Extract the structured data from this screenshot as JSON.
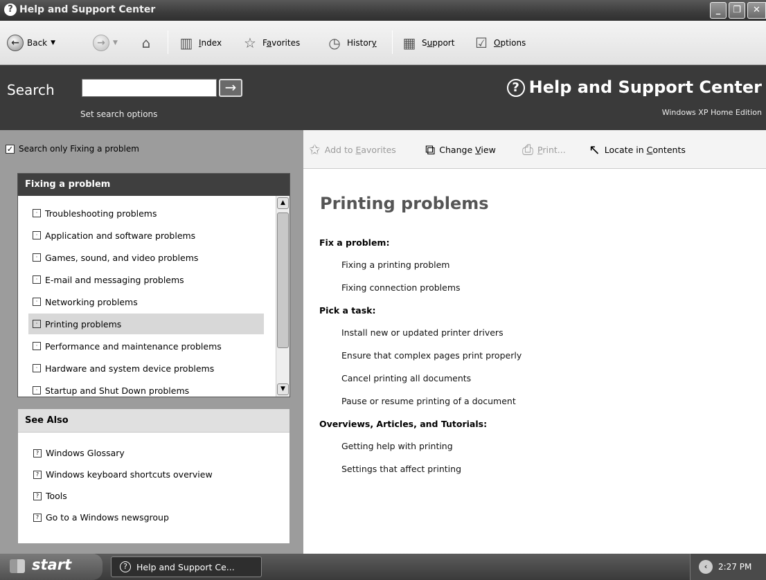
{
  "window": {
    "title": "Help and Support Center",
    "controls": {
      "minimize": "_",
      "restore": "❐",
      "close": "✕"
    }
  },
  "toolbar": {
    "back": "Back",
    "index_prefix": "",
    "index_u": "I",
    "index_rest": "ndex",
    "favorites_pre": "F",
    "favorites_u": "a",
    "favorites_rest": "vorites",
    "history_pre": "Histor",
    "history_u": "y",
    "support_pre": "S",
    "support_u": "u",
    "support_rest": "pport",
    "options_u": "O",
    "options_rest": "ptions",
    "icons": [
      "back-arrow-icon",
      "forward-arrow-icon",
      "home-icon",
      "index-book-icon",
      "favorites-star-icon",
      "history-clock-icon",
      "support-icon",
      "options-checklist-icon"
    ]
  },
  "search": {
    "label": "Search",
    "value": "",
    "go": "→",
    "options_link": "Set search options",
    "brand": "Help and Support Center",
    "edition": "Windows XP Home Edition"
  },
  "left": {
    "scope_label": "Search only Fixing a problem",
    "scope_checked": true,
    "fix_header": "Fixing a problem",
    "fix_items": [
      "Troubleshooting problems",
      "Application and software problems",
      "Games, sound, and video problems",
      "E-mail and messaging problems",
      "Networking problems",
      "Printing problems",
      "Performance and maintenance problems",
      "Hardware and system device problems",
      "Startup and Shut Down problems"
    ],
    "selected_index": 5,
    "see_also_header": "See Also",
    "see_also_items": [
      "Windows Glossary",
      "Windows keyboard shortcuts overview",
      "Tools",
      "Go to a Windows newsgroup"
    ]
  },
  "content_toolbar": {
    "add_fav_pre": "Add to ",
    "add_fav_u": "E",
    "add_fav_rest": "avorites",
    "change_view_pre": "Change ",
    "change_view_u": "V",
    "change_view_rest": "iew",
    "print_u": "P",
    "print_rest": "rint...",
    "locate_pre": "Locate in ",
    "locate_u": "C",
    "locate_rest": "ontents"
  },
  "content": {
    "title": "Printing problems",
    "sections": [
      {
        "heading": "Fix a problem:",
        "links": [
          "Fixing a printing problem",
          "Fixing connection problems"
        ]
      },
      {
        "heading": "Pick a task:",
        "links": [
          "Install new or updated printer drivers",
          "Ensure that complex pages print properly",
          "Cancel printing all documents",
          "Pause or resume printing of a document"
        ]
      },
      {
        "heading": "Overviews, Articles, and Tutorials:",
        "links": [
          "Getting help with printing",
          "Settings that affect printing"
        ]
      }
    ]
  },
  "taskbar": {
    "start": "start",
    "task": "Help and Support Ce...",
    "clock": "2:27 PM"
  }
}
